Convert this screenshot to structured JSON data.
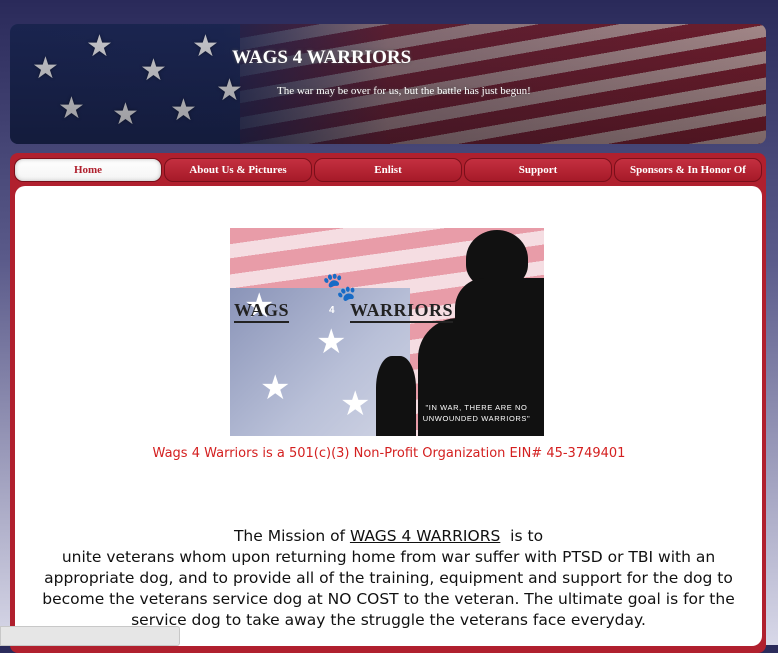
{
  "header": {
    "title": "WAGS 4 WARRIORS",
    "tagline": "The war may be over for us, but the battle has just begun!"
  },
  "nav": {
    "tabs": [
      {
        "label": "Home",
        "active": true
      },
      {
        "label": "About Us & Pictures",
        "active": false
      },
      {
        "label": "Enlist",
        "active": false
      },
      {
        "label": "Support",
        "active": false
      },
      {
        "label": "Sponsors & In Honor Of",
        "active": false
      }
    ]
  },
  "logo": {
    "left_word": "WAGS",
    "number": "4",
    "right_word": "WARRIORS",
    "quote": "\"IN WAR, THERE ARE NO UNWOUNDED WARRIORS\""
  },
  "nonprofit_notice": "Wags 4 Warriors is a 501(c)(3) Non-Profit Organization EIN# 45-3749401",
  "mission": {
    "prefix": "The Mission of ",
    "org_name": "WAGS 4 WARRIORS",
    "suffix": "  is to",
    "body": "unite veterans whom upon returning home from war suffer with PTSD or TBI with an appropriate dog, and to provide all of the training, equipment and support for the dog to become the veterans service dog at NO COST to the veteran. The ultimate goal is for the service dog to take away the struggle the veterans face everyday."
  },
  "colors": {
    "nav_red": "#b0202e",
    "notice_red": "#d42020",
    "banner_navy": "#1e2a5c"
  }
}
